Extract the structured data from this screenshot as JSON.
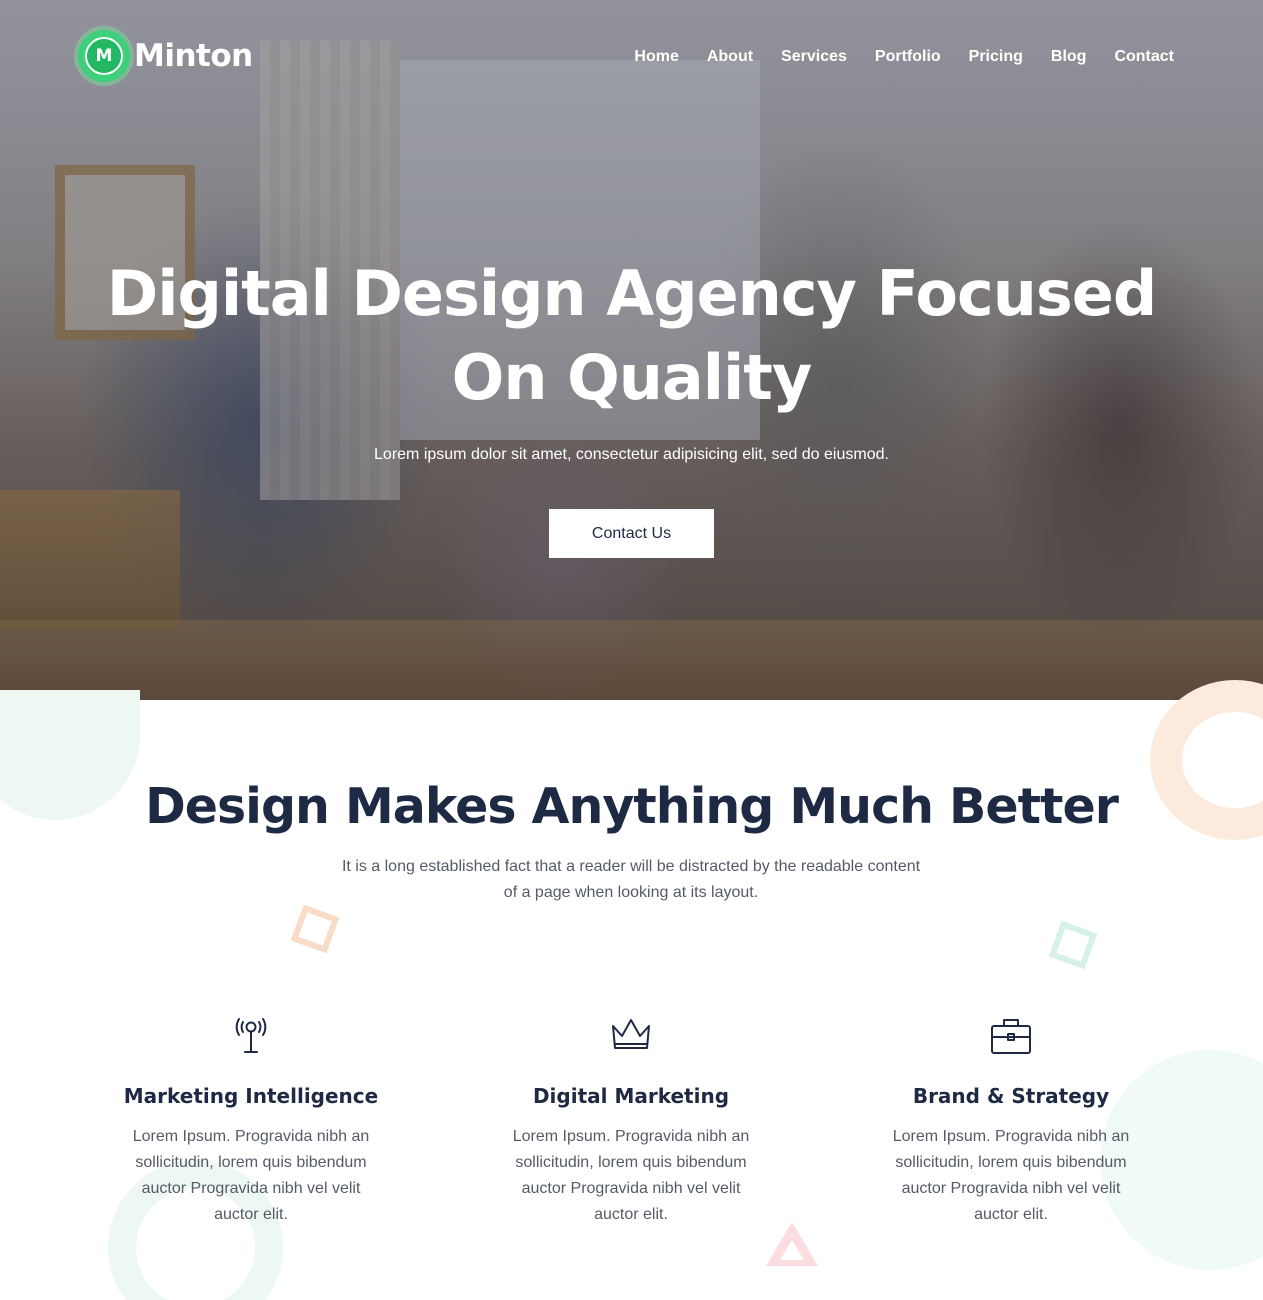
{
  "brand": {
    "logo_letter": "M",
    "name": "Minton",
    "accent_color": "#3ecf7b"
  },
  "nav": {
    "items": [
      {
        "label": "Home"
      },
      {
        "label": "About"
      },
      {
        "label": "Services"
      },
      {
        "label": "Portfolio"
      },
      {
        "label": "Pricing"
      },
      {
        "label": "Blog"
      },
      {
        "label": "Contact"
      }
    ]
  },
  "hero": {
    "title_line1": "Digital Design Agency Focused",
    "title_line2": "On Quality",
    "subtitle": "Lorem ipsum dolor sit amet, consectetur adipisicing elit, sed do eiusmod.",
    "button_label": "Contact Us"
  },
  "section": {
    "title": "Design Makes Anything Much Better",
    "subtitle_line1": "It is a long established fact that a reader will be distracted by the readable content",
    "subtitle_line2": "of a page when looking at its layout."
  },
  "features": [
    {
      "icon": "antenna-icon",
      "title": "Marketing Intelligence",
      "text": "Lorem Ipsum. Progravida nibh an sollicitudin, lorem quis bibendum auctor Progravida nibh vel velit auctor elit."
    },
    {
      "icon": "crown-icon",
      "title": "Digital Marketing",
      "text": "Lorem Ipsum. Progravida nibh an sollicitudin, lorem quis bibendum auctor Progravida nibh vel velit auctor elit."
    },
    {
      "icon": "briefcase-icon",
      "title": "Brand & Strategy",
      "text": "Lorem Ipsum. Progravida nibh an sollicitudin, lorem quis bibendum auctor Progravida nibh vel velit auctor elit."
    }
  ]
}
